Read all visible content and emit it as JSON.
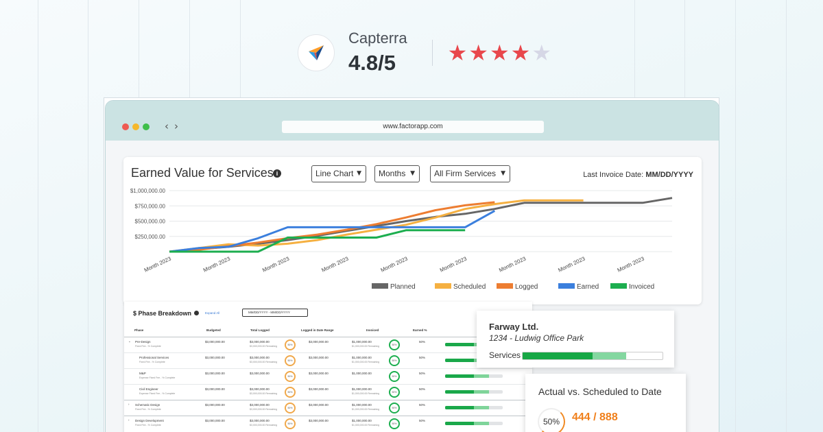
{
  "rating": {
    "platform": "Capterra",
    "score": "4.8/5",
    "stars_filled": 4,
    "stars_total": 5,
    "star_color": "#e8474c",
    "star_empty_color": "#d6d7e6",
    "logo_icon": "capterra-arrow-icon"
  },
  "browser": {
    "url": "www.factorapp.com",
    "dot_colors": [
      "#ee5a52",
      "#f5b82c",
      "#3fbf4b"
    ],
    "nav_icons": [
      "chevron-left-icon",
      "chevron-right-icon"
    ]
  },
  "earned_value": {
    "title": "Earned Value for Services",
    "chart_type_select": "Line Chart",
    "period_select": "Months",
    "scope_select": "All Firm Services",
    "invoice_label": "Last Invoice Date:",
    "invoice_value": "MM/DD/YYYY"
  },
  "chart_data": {
    "type": "line",
    "x": [
      "Month 2023",
      "Month 2023",
      "Month 2023",
      "Month 2023",
      "Month 2023",
      "Month 2023",
      "Month 2023",
      "Month 2023",
      "Month 2023",
      "Month 2023",
      "Month 2023",
      "Month 2023",
      "Month 2023",
      "Month 2023",
      "Month 2023",
      "Month 2023",
      "Month 2023",
      "Month 2023"
    ],
    "y_ticks": [
      "$1,000,000.00",
      "$750,000.00",
      "$500,000.00",
      "$250,000.00"
    ],
    "ylim": [
      0,
      1000000
    ],
    "grid": true,
    "legend_position": "bottom",
    "series": [
      {
        "name": "Planned",
        "color": "#666666",
        "values": [
          0,
          40000,
          80000,
          130000,
          190000,
          260000,
          340000,
          420000,
          500000,
          570000,
          620000,
          700000,
          800000,
          800000,
          800000,
          800000,
          800000,
          880000
        ]
      },
      {
        "name": "Scheduled",
        "color": "#f5b041",
        "values": [
          0,
          60000,
          120000,
          100000,
          130000,
          190000,
          280000,
          360000,
          440000,
          560000,
          700000,
          780000,
          840000,
          840000,
          840000
        ]
      },
      {
        "name": "Logged",
        "color": "#ed7d31",
        "values": [
          0,
          30000,
          90000,
          150000,
          220000,
          280000,
          360000,
          450000,
          560000,
          680000,
          760000,
          810000
        ]
      },
      {
        "name": "Earned",
        "color": "#3b7fdd",
        "values": [
          0,
          60000,
          80000,
          220000,
          400000,
          400000,
          400000,
          400000,
          400000,
          400000,
          400000,
          670000
        ]
      },
      {
        "name": "Invoiced",
        "color": "#1cae4f",
        "values": [
          0,
          0,
          0,
          0,
          230000,
          230000,
          230000,
          230000,
          350000,
          350000,
          350000
        ]
      }
    ]
  },
  "phase_breakdown": {
    "title": "$ Phase Breakdown",
    "expand_all": "Expand All",
    "date_range": "MM/DD/YYYY - MM/DD/YYYY",
    "headers": [
      "Phase",
      "Budgeted",
      "Total Logged",
      "Logged in Date Range",
      "Invoiced",
      "Earned %"
    ],
    "rows": [
      {
        "name": "Pre-Design",
        "sub": "Fixed Fee - % Complete",
        "budgeted": "$3,000,000.00",
        "logged": "$3,000,000.00",
        "logged_sub": "$3,000,000.00 Remaining",
        "range": "$3,000,000.00",
        "invoiced": "$1,000,000.00",
        "invoiced_sub": "$1,000,000.00 Remaining",
        "pct": "50%",
        "logged_pct": "50%",
        "inv_pct": "50%",
        "expanded": true,
        "indent": false
      },
      {
        "name": "Professional Services",
        "sub": "Fixed Fee - % Complete",
        "budgeted": "$3,000,000.00",
        "logged": "$3,000,000.00",
        "logged_sub": "$3,000,000.00 Remaining",
        "range": "$3,000,000.00",
        "invoiced": "$1,000,000.00",
        "invoiced_sub": "$1,000,000.00 Remaining",
        "pct": "50%",
        "logged_pct": "50%",
        "inv_pct": "50%",
        "expanded": false,
        "indent": true
      },
      {
        "name": "M&P",
        "sub": "Expense Fixed Fee - % Complete",
        "budgeted": "$3,000,000.00",
        "logged": "$3,000,000.00",
        "logged_sub": "",
        "range": "$3,000,000.00",
        "invoiced": "$1,000,000.00",
        "invoiced_sub": "",
        "pct": "50%",
        "logged_pct": "50%",
        "inv_pct": "50%",
        "expanded": false,
        "indent": true
      },
      {
        "name": "Civil Engineer",
        "sub": "Expense Fixed Fee - % Complete",
        "budgeted": "$3,000,000.00",
        "logged": "$3,000,000.00",
        "logged_sub": "$3,000,000.00 Remaining",
        "range": "$3,000,000.00",
        "invoiced": "$1,000,000.00",
        "invoiced_sub": "$1,000,000.00 Remaining",
        "pct": "50%",
        "logged_pct": "50%",
        "inv_pct": "50%",
        "expanded": false,
        "indent": true
      },
      {
        "name": "Schematic Design",
        "sub": "Fixed Fee - % Complete",
        "budgeted": "$3,000,000.00",
        "logged": "$3,000,000.00",
        "logged_sub": "$3,000,000.00 Remaining",
        "range": "$3,000,000.00",
        "invoiced": "$1,000,000.00",
        "invoiced_sub": "$1,000,000.00 Remaining",
        "pct": "50%",
        "logged_pct": "50%",
        "inv_pct": "50%",
        "expanded": false,
        "indent": false
      },
      {
        "name": "Design Development",
        "sub": "Fixed Fee - % Complete",
        "budgeted": "$3,000,000.00",
        "logged": "$3,000,000.00",
        "logged_sub": "$3,000,000.00 Remaining",
        "range": "$3,000,000.00",
        "invoiced": "$1,000,000.00",
        "invoiced_sub": "$1,000,000.00 Remaining",
        "pct": "50%",
        "logged_pct": "50%",
        "inv_pct": "50%",
        "expanded": false,
        "indent": false
      }
    ]
  },
  "client_card": {
    "name": "Farway Ltd.",
    "address": "1234 - Ludwig Office Park",
    "services_label": "Services",
    "services_progress_dark": 0.5,
    "services_progress_light": 0.74
  },
  "actual_vs_scheduled": {
    "title": "Actual vs. Scheduled to Date",
    "percent": "50%",
    "value": "444 / 888",
    "accent": "#f07f1a"
  }
}
